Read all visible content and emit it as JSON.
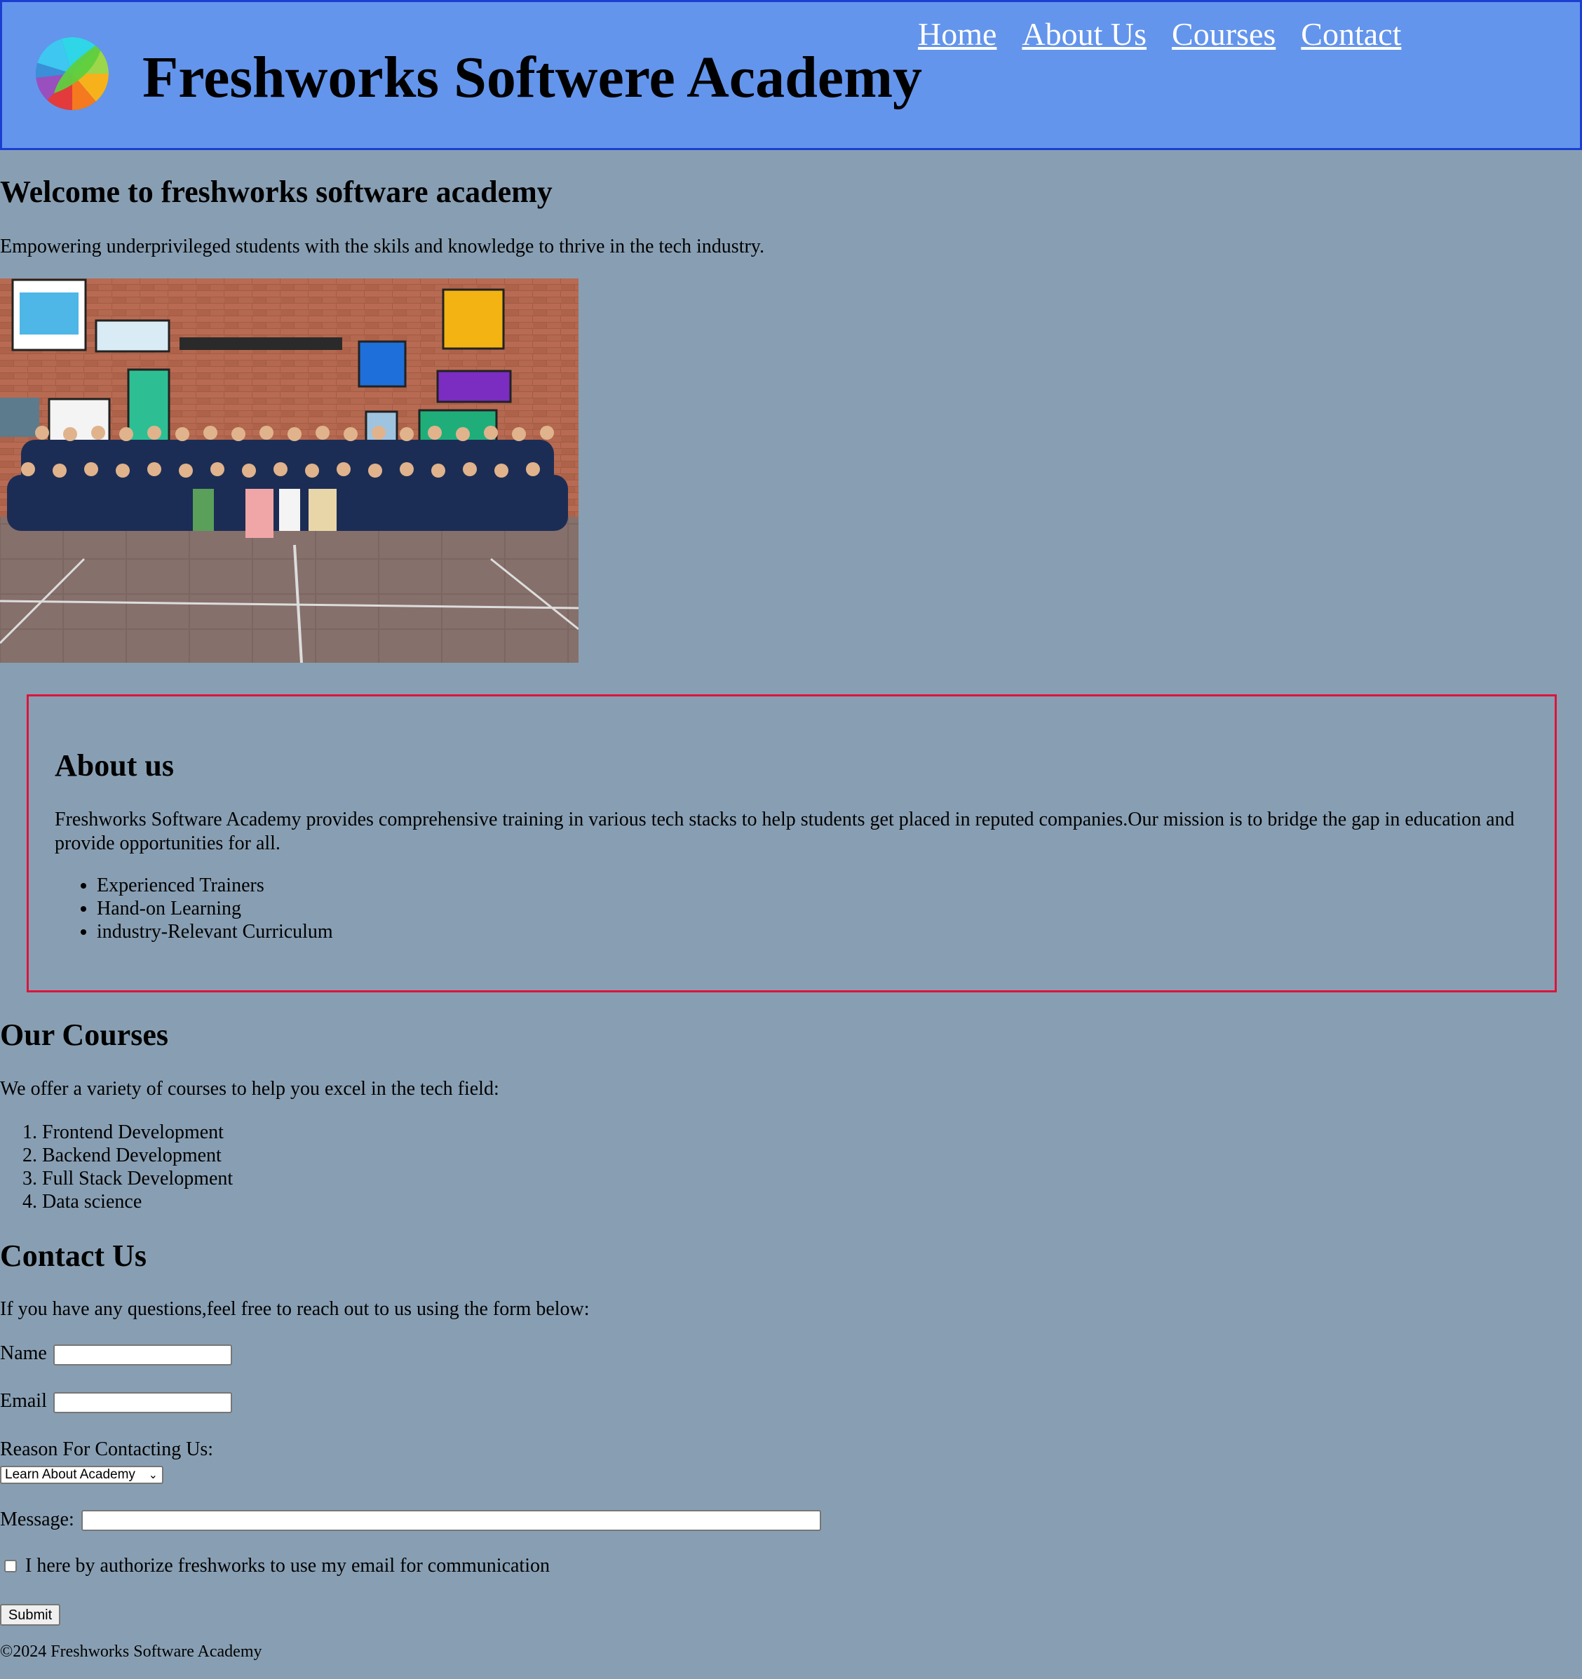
{
  "header": {
    "title": "Freshworks Softwere Academy",
    "logo_icon": "freshworks-logo-icon",
    "colors": {
      "background": "#6495ec",
      "border": "#1a3fd0",
      "nav_link": "#ffffff"
    },
    "nav": [
      {
        "label": "Home"
      },
      {
        "label": "About Us"
      },
      {
        "label": "Courses"
      },
      {
        "label": "Contact"
      }
    ]
  },
  "page": {
    "background": "#889fb3"
  },
  "welcome": {
    "title": "Welcome to freshworks software academy",
    "text": "Empowering underprivileged students with the skils and knowledge to thrive in the tech industry."
  },
  "about": {
    "border_color": "#dc143c",
    "title": "About us",
    "text": "Freshworks Software Academy provides comprehensive training in various tech stacks to help students get placed in reputed companies.Our mission is to bridge the gap in education and provide opportunities for all.",
    "features": [
      "Experienced Trainers",
      "Hand-on Learning",
      "industry-Relevant Curriculum"
    ]
  },
  "courses": {
    "title": "Our Courses",
    "text": "We offer a variety of courses to help you excel in the tech field:",
    "items": [
      "Frontend Development",
      "Backend Development",
      "Full Stack Development",
      "Data science"
    ]
  },
  "contact": {
    "title": "Contact Us",
    "text": "If you have any questions,feel free to reach out to us using the form below:",
    "name_label": "Name",
    "name_value": "",
    "email_label": "Email",
    "email_value": "",
    "reason_label": "Reason For Contacting Us:",
    "reason_selected": "Learn About Academy",
    "message_label": "Message:",
    "message_value": "",
    "consent_label": "I here by authorize freshworks to use my email for communication",
    "consent_checked": false,
    "submit_label": "Submit"
  },
  "footer": {
    "text": "©2024 Freshworks Software Academy"
  }
}
